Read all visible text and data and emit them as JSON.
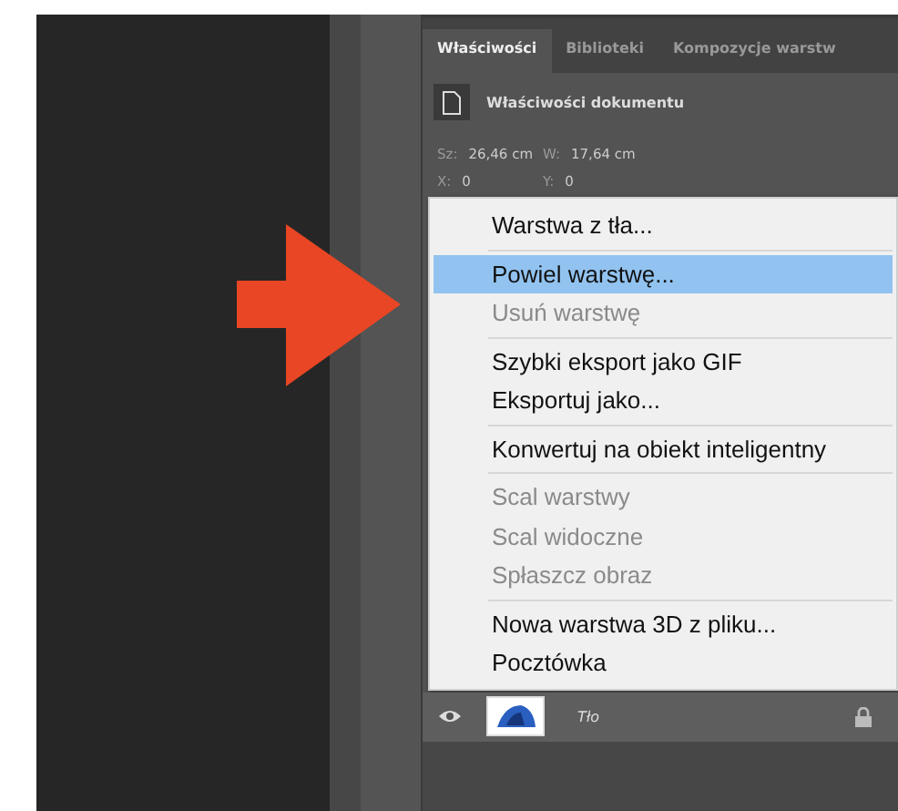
{
  "panel": {
    "tabs": [
      {
        "label": "Właściwości",
        "selected": true
      },
      {
        "label": "Biblioteki",
        "selected": false
      },
      {
        "label": "Kompozycje warstw",
        "selected": false
      }
    ],
    "header": "Właściwości dokumentu",
    "properties": [
      {
        "label": "Sz:",
        "value": "26,46 cm"
      },
      {
        "label": "W:",
        "value": "17,64 cm"
      },
      {
        "label": "X:",
        "value": "0"
      },
      {
        "label": "Y:",
        "value": "0"
      }
    ]
  },
  "context_menu": {
    "groups": [
      [
        {
          "label": "Warstwa z tła...",
          "disabled": false,
          "selected": false
        }
      ],
      [
        {
          "label": "Powiel warstwę...",
          "disabled": false,
          "selected": true
        },
        {
          "label": "Usuń warstwę",
          "disabled": true,
          "selected": false
        }
      ],
      [
        {
          "label": "Szybki eksport jako GIF",
          "disabled": false,
          "selected": false
        },
        {
          "label": "Eksportuj jako...",
          "disabled": false,
          "selected": false
        }
      ],
      [
        {
          "label": "Konwertuj na obiekt inteligentny",
          "disabled": false,
          "selected": false
        }
      ],
      [
        {
          "label": "Scal warstwy",
          "disabled": true,
          "selected": false
        },
        {
          "label": "Scal widoczne",
          "disabled": true,
          "selected": false
        },
        {
          "label": "Spłaszcz obraz",
          "disabled": true,
          "selected": false
        }
      ],
      [
        {
          "label": "Nowa warstwa 3D z pliku...",
          "disabled": false,
          "selected": false
        },
        {
          "label": "Pocztówka",
          "disabled": false,
          "selected": false
        }
      ]
    ]
  },
  "layer": {
    "name": "Tło",
    "visible": true,
    "locked": true
  }
}
